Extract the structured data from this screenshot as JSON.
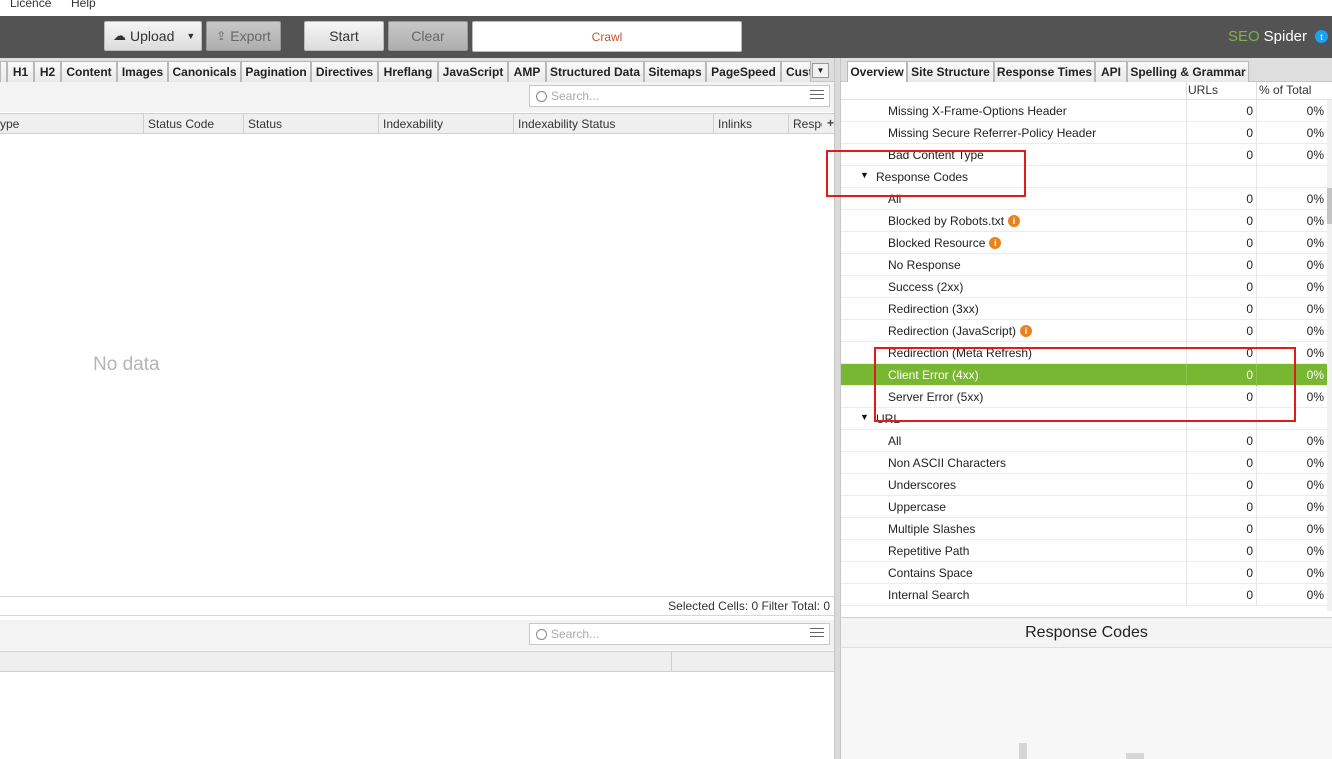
{
  "menu": {
    "licence": "Licence",
    "help": "Help"
  },
  "toolbar": {
    "upload": "Upload",
    "export": "Export",
    "start": "Start",
    "clear": "Clear",
    "crawl": "Crawl"
  },
  "brand": {
    "seo": "SEO",
    "spider": "Spider"
  },
  "left_tabs": [
    "H1",
    "H2",
    "Content",
    "Images",
    "Canonicals",
    "Pagination",
    "Directives",
    "Hreflang",
    "JavaScript",
    "AMP",
    "Structured Data",
    "Sitemaps",
    "PageSpeed",
    "Cust"
  ],
  "search": {
    "placeholder": "Search..."
  },
  "columns": [
    "ype",
    "Status Code",
    "Status",
    "Indexability",
    "Indexability Status",
    "Inlinks",
    "Respo"
  ],
  "no_data": "No data",
  "status_bar": {
    "text": "Selected Cells:  0  Filter Total:  0"
  },
  "right_tabs": [
    "Overview",
    "Site Structure",
    "Response Times",
    "API",
    "Spelling & Grammar"
  ],
  "tree_header": {
    "urls": "URLs",
    "pct": "% of Total"
  },
  "tree_rows": [
    {
      "label": "Missing X-Frame-Options Header",
      "urls": "0",
      "pct": "0%"
    },
    {
      "label": "Missing Secure Referrer-Policy Header",
      "urls": "0",
      "pct": "0%"
    },
    {
      "label": "Bad Content Type",
      "urls": "0",
      "pct": "0%"
    },
    {
      "label": "Response Codes",
      "group": true
    },
    {
      "label": "All",
      "urls": "0",
      "pct": "0%"
    },
    {
      "label": "Blocked by Robots.txt",
      "urls": "0",
      "pct": "0%",
      "info": true
    },
    {
      "label": "Blocked Resource",
      "urls": "0",
      "pct": "0%",
      "info": true
    },
    {
      "label": "No Response",
      "urls": "0",
      "pct": "0%"
    },
    {
      "label": "Success (2xx)",
      "urls": "0",
      "pct": "0%"
    },
    {
      "label": "Redirection (3xx)",
      "urls": "0",
      "pct": "0%"
    },
    {
      "label": "Redirection (JavaScript)",
      "urls": "0",
      "pct": "0%",
      "info": true
    },
    {
      "label": "Redirection (Meta Refresh)",
      "urls": "0",
      "pct": "0%"
    },
    {
      "label": "Client Error (4xx)",
      "urls": "0",
      "pct": "0%",
      "selected": true
    },
    {
      "label": "Server Error (5xx)",
      "urls": "0",
      "pct": "0%"
    },
    {
      "label": "URL",
      "group": true
    },
    {
      "label": "All",
      "urls": "0",
      "pct": "0%"
    },
    {
      "label": "Non ASCII Characters",
      "urls": "0",
      "pct": "0%"
    },
    {
      "label": "Underscores",
      "urls": "0",
      "pct": "0%"
    },
    {
      "label": "Uppercase",
      "urls": "0",
      "pct": "0%"
    },
    {
      "label": "Multiple Slashes",
      "urls": "0",
      "pct": "0%"
    },
    {
      "label": "Repetitive Path",
      "urls": "0",
      "pct": "0%"
    },
    {
      "label": "Contains Space",
      "urls": "0",
      "pct": "0%"
    },
    {
      "label": "Internal Search",
      "urls": "0",
      "pct": "0%"
    }
  ],
  "chart": {
    "title": "Response Codes"
  },
  "colors": {
    "toolbar": "#535353",
    "selected_row": "#77b731",
    "annotation": "#e01b1b",
    "info_icon": "#e8821e"
  }
}
